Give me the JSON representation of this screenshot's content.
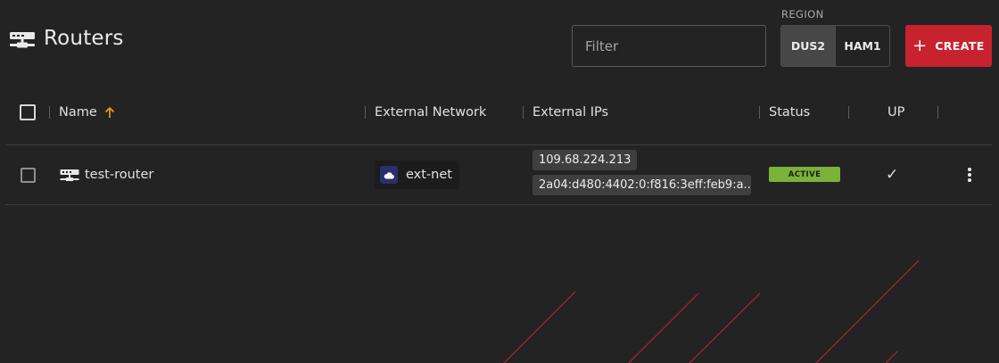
{
  "header": {
    "title": "Routers",
    "title_icon": "router-icon"
  },
  "filter": {
    "placeholder": "Filter",
    "value": ""
  },
  "region": {
    "label": "REGION",
    "options": [
      "DUS2",
      "HAM1"
    ],
    "selected": "DUS2"
  },
  "create_button": {
    "icon": "plus-icon",
    "label": "CREATE"
  },
  "table": {
    "columns": [
      "Name",
      "External Network",
      "External IPs",
      "Status",
      "UP"
    ],
    "sort_column": "Name",
    "sort_direction": "ascending",
    "rows": [
      {
        "name": "test-router",
        "external_network": "ext-net",
        "external_ips": [
          "109.68.224.213",
          "2a04:d480:4402:0:f816:3eff:feb9:a..."
        ],
        "status": "ACTIVE",
        "up": "✓"
      }
    ]
  },
  "colors": {
    "background": "#232323",
    "accent_red": "#c8222e",
    "status_active": "#7bb23a",
    "sort_arrow": "#f0a020",
    "network_icon_bg": "#2b2f6b"
  }
}
